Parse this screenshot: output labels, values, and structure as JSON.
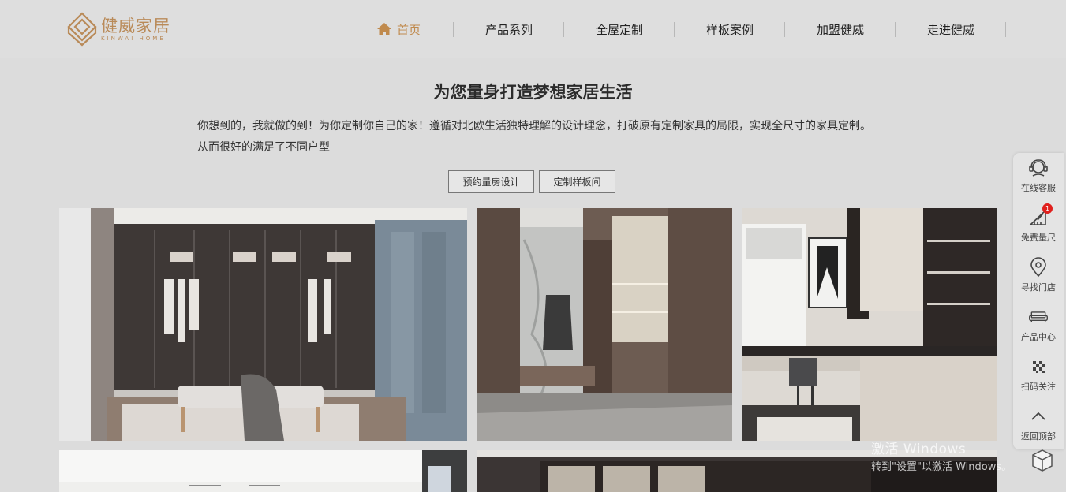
{
  "brand": {
    "name_cn": "健威家居",
    "name_en": "KINWAI HOME",
    "color": "#b98a58"
  },
  "nav": {
    "items": [
      {
        "label": "首页",
        "icon": "home-icon",
        "active": true
      },
      {
        "label": "产品系列"
      },
      {
        "label": "全屋定制"
      },
      {
        "label": "样板案例"
      },
      {
        "label": "加盟健威"
      },
      {
        "label": "走进健威"
      }
    ],
    "active_color": "#c08a4d"
  },
  "intro": {
    "title": "为您量身打造梦想家居生活",
    "text": "你想到的，我就做的到！为你定制你自己的家！遵循对北欧生活独特理解的设计理念，打破原有定制家具的局限，实现全尺寸的家具定制。从而很好的满足了不同户型",
    "buttons": [
      "预约量房设计",
      "定制样板间"
    ]
  },
  "gallery": {
    "images": [
      {
        "name": "walk-in-wardrobe"
      },
      {
        "name": "entryway-cabinet"
      },
      {
        "name": "study-room"
      },
      {
        "name": "ceiling-room"
      },
      {
        "name": "cabinet-wall"
      }
    ]
  },
  "side_bar": {
    "items": [
      {
        "label": "在线客服",
        "icon": "customer-service-icon"
      },
      {
        "label": "免费量尺",
        "icon": "ruler-pencil-icon",
        "badge": "1"
      },
      {
        "label": "寻找门店",
        "icon": "location-pin-icon"
      },
      {
        "label": "产品中心",
        "icon": "sofa-icon"
      },
      {
        "label": "扫码关注",
        "icon": "qr-code-icon"
      },
      {
        "label": "返回顶部",
        "icon": "chevron-up-icon"
      }
    ]
  },
  "watermark": {
    "line1": "激活 Windows",
    "line2": "转到\"设置\"以激活 Windows。"
  }
}
